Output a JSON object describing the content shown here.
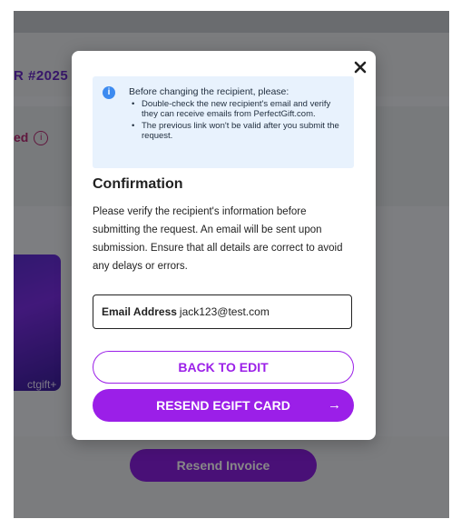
{
  "background": {
    "order_number": "R #2025",
    "status_text": "ed",
    "card_label": "ctgift+",
    "resend_invoice_label": "Resend Invoice"
  },
  "modal": {
    "close_label": "×",
    "notice": {
      "title": "Before changing the recipient, please:",
      "items": [
        "Double-check the new recipient's email and verify they can receive emails from PerfectGift.com.",
        "The previous link won't be valid after you submit the request."
      ]
    },
    "confirmation_title": "Confirmation",
    "confirmation_body": "Please verify the recipient's information before submitting the request. An email will be sent upon submission. Ensure that all details are correct to avoid any delays or errors.",
    "email": {
      "label": "Email Address",
      "value": "jack123@test.com"
    },
    "back_button_label": "BACK TO EDIT",
    "resend_button_label": "RESEND EGIFT CARD"
  },
  "colors": {
    "accent": "#9b1fe8",
    "notice_bg": "#e8f2fd",
    "info_icon": "#3d8bf0"
  },
  "icons": {
    "close": "close-icon",
    "info": "info-icon",
    "arrow": "arrow-right-icon"
  }
}
